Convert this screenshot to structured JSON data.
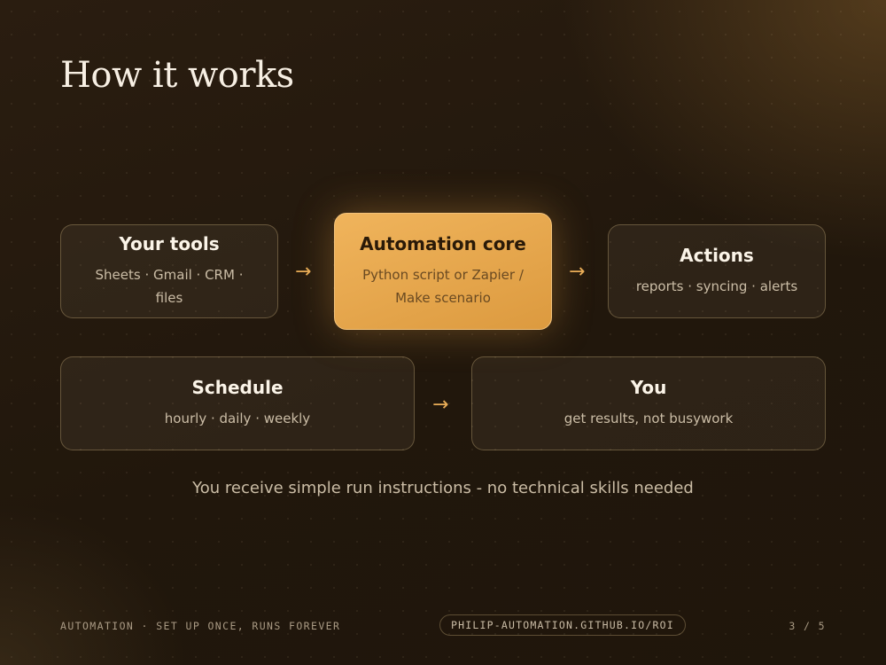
{
  "title": "How it works",
  "flow": {
    "your_tools": {
      "heading": "Your tools",
      "detail": "Sheets · Gmail · CRM · files"
    },
    "automation_core": {
      "heading": "Automation core",
      "detail": "Python script or Zapier / Make scenario"
    },
    "actions": {
      "heading": "Actions",
      "detail": "reports · syncing · alerts"
    },
    "schedule": {
      "heading": "Schedule",
      "detail": "hourly · daily · weekly"
    },
    "you": {
      "heading": "You",
      "detail": "get results, not busywork"
    },
    "arrow_glyph": "→"
  },
  "note": "You receive simple run instructions - no technical skills needed",
  "footer": {
    "tagline": "AUTOMATION · SET UP ONCE, RUNS FOREVER",
    "url": "PHILIP-AUTOMATION.GITHUB.IO/ROI",
    "page": "3 / 5"
  },
  "colors": {
    "accent": "#e9ad57",
    "background": "#21170c",
    "core_fill": "#e8a94f"
  }
}
